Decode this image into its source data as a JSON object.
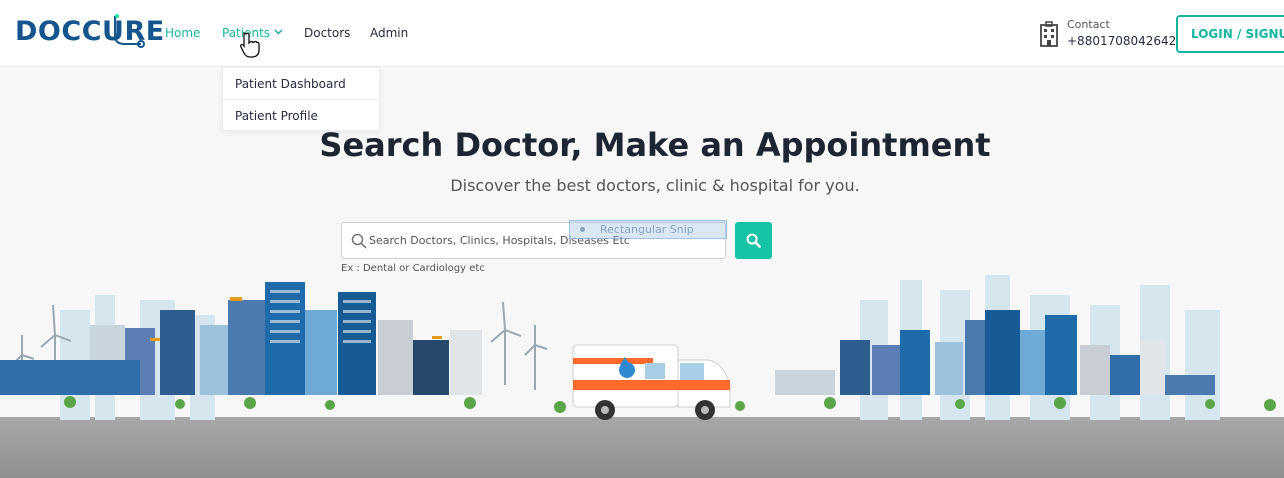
{
  "brand": {
    "logo_text_a": "DOC",
    "logo_text_b": "C",
    "logo_text_c": "URE"
  },
  "nav": {
    "home": "Home",
    "patients": "Patients",
    "doctors": "Doctors",
    "admin": "Admin"
  },
  "patients_menu": [
    "Patient Dashboard",
    "Patient Profile"
  ],
  "contact": {
    "label": "Contact",
    "phone": "+8801708042642"
  },
  "login_label": "LOGIN / SIGNUP",
  "hero": {
    "title": "Search Doctor, Make an Appointment",
    "subtitle": "Discover the best doctors, clinic & hospital for you."
  },
  "search": {
    "placeholder": "Search Doctors, Clinics, Hospitals, Diseases Etc",
    "hint": "Ex : Dental or Cardiology etc",
    "overlay_label": "Rectangular Snip"
  },
  "colors": {
    "accent": "#15b5a0",
    "brand_blue": "#15558d",
    "brand_green": "#09e5ab"
  },
  "icons": [
    "stethoscope-icon",
    "chevron-down-icon",
    "hand-pointer-cursor-icon",
    "hospital-building-icon",
    "search-icon"
  ]
}
